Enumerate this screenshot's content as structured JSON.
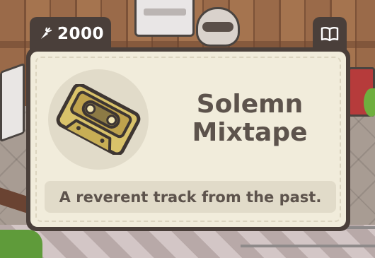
{
  "currency": {
    "value": "2000",
    "icon": "carrot-icon",
    "color": "#e06a2a"
  },
  "book_button": {
    "icon": "open-book-icon"
  },
  "item": {
    "name_line1": "Solemn",
    "name_line2": "Mixtape",
    "description": "A reverent track from the past.",
    "icon": "cassette-tape-icon"
  },
  "colors": {
    "panel_dark": "#4a3f3a",
    "card_bg": "#f1ecdb",
    "text": "#5d534c",
    "cassette_gold": "#d9c26a"
  }
}
